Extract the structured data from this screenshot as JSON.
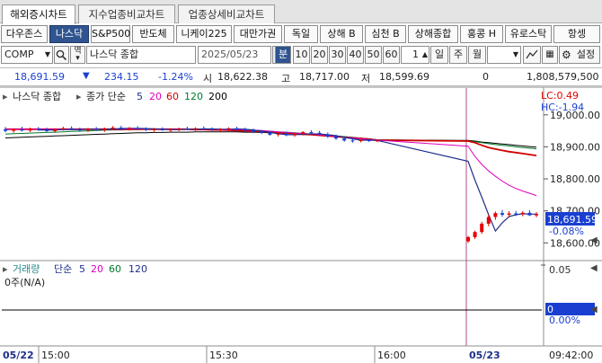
{
  "tabs": [
    "해외증시차트",
    "지수업종비교차트",
    "업종상세비교차트"
  ],
  "categories": [
    "다우존스",
    "나스닥",
    "S&P500",
    "반도체",
    "니케이225",
    "대만가권",
    "독일",
    "상해 B",
    "심천 B",
    "상해종합",
    "홍콩 H",
    "유로스탁",
    "항셍"
  ],
  "controls": {
    "symbol": "COMP",
    "index_name": "나스닥 종합",
    "date": "2025/05/23",
    "periods": [
      "분",
      "10",
      "20",
      "30",
      "40",
      "50",
      "60"
    ],
    "count": "1",
    "units": [
      "일",
      "주",
      "월"
    ],
    "settings_label": "설정"
  },
  "info": {
    "price": "18,691.59",
    "arrow": "▼",
    "change": "234.15",
    "change_pct": "-1.24%",
    "open_label": "시",
    "open": "18,622.38",
    "high_label": "고",
    "high": "18,717.00",
    "low_label": "저",
    "low": "18,599.69",
    "volume": "0",
    "amount": "1,808,579,500"
  },
  "price_panel": {
    "name": "나스닥 종합",
    "ma_label": "종가 단순",
    "ma_periods": [
      "5",
      "20",
      "60",
      "120",
      "200"
    ],
    "lc": "LC:0.49",
    "hc": "HC:-1.94",
    "y_ticks": [
      "19,000.00",
      "18,900.00",
      "18,800.00",
      "18,700.00",
      "18,600.00"
    ],
    "last_price": "18,691.59",
    "last_pct": "-0.08%"
  },
  "volume_panel": {
    "name": "거래량",
    "ma_label": "단순",
    "ma_periods": [
      "5",
      "20",
      "60",
      "120"
    ],
    "status": "0주(N/A)",
    "y_top": "0.05",
    "last_val": "0",
    "last_pct": "0.00%"
  },
  "x_axis": {
    "labels": [
      "05/22",
      "15:00",
      "15:30",
      "16:00",
      "05/23"
    ],
    "time": "09:42:00"
  },
  "colors": {
    "up": "#e60000",
    "down": "#1a3fd0",
    "ma5": "#1f2f8a",
    "ma20": "#e000c0",
    "ma60": "#d00000",
    "ma120": "#007a2e",
    "ma200": "#000000",
    "accent": "#2f5490"
  },
  "chart_data": {
    "type": "candlestick",
    "ylim": [
      18570,
      19050
    ],
    "candles": [
      {
        "o": 18955,
        "h": 18962,
        "l": 18945,
        "c": 18950
      },
      {
        "o": 18950,
        "h": 18958,
        "l": 18944,
        "c": 18955
      },
      {
        "o": 18955,
        "h": 18963,
        "l": 18948,
        "c": 18951
      },
      {
        "o": 18951,
        "h": 18960,
        "l": 18946,
        "c": 18957
      },
      {
        "o": 18957,
        "h": 18962,
        "l": 18950,
        "c": 18953
      },
      {
        "o": 18953,
        "h": 18960,
        "l": 18947,
        "c": 18949
      },
      {
        "o": 18949,
        "h": 18958,
        "l": 18944,
        "c": 18955
      },
      {
        "o": 18955,
        "h": 18963,
        "l": 18951,
        "c": 18958
      },
      {
        "o": 18958,
        "h": 18964,
        "l": 18952,
        "c": 18954
      },
      {
        "o": 18954,
        "h": 18960,
        "l": 18948,
        "c": 18952
      },
      {
        "o": 18952,
        "h": 18959,
        "l": 18946,
        "c": 18956
      },
      {
        "o": 18956,
        "h": 18962,
        "l": 18950,
        "c": 18953
      },
      {
        "o": 18953,
        "h": 18960,
        "l": 18947,
        "c": 18958
      },
      {
        "o": 18958,
        "h": 18965,
        "l": 18953,
        "c": 18960
      },
      {
        "o": 18960,
        "h": 18966,
        "l": 18954,
        "c": 18957
      },
      {
        "o": 18957,
        "h": 18962,
        "l": 18951,
        "c": 18959
      },
      {
        "o": 18959,
        "h": 18965,
        "l": 18954,
        "c": 18956
      },
      {
        "o": 18956,
        "h": 18961,
        "l": 18949,
        "c": 18953
      },
      {
        "o": 18953,
        "h": 18959,
        "l": 18947,
        "c": 18955
      },
      {
        "o": 18955,
        "h": 18961,
        "l": 18950,
        "c": 18952
      },
      {
        "o": 18952,
        "h": 18958,
        "l": 18946,
        "c": 18954
      },
      {
        "o": 18954,
        "h": 18960,
        "l": 18949,
        "c": 18957
      },
      {
        "o": 18957,
        "h": 18963,
        "l": 18952,
        "c": 18955
      },
      {
        "o": 18955,
        "h": 18961,
        "l": 18950,
        "c": 18958
      },
      {
        "o": 18958,
        "h": 18964,
        "l": 18953,
        "c": 18956
      },
      {
        "o": 18956,
        "h": 18961,
        "l": 18950,
        "c": 18953
      },
      {
        "o": 18953,
        "h": 18959,
        "l": 18947,
        "c": 18955
      },
      {
        "o": 18955,
        "h": 18961,
        "l": 18949,
        "c": 18958
      },
      {
        "o": 18958,
        "h": 18963,
        "l": 18952,
        "c": 18954
      },
      {
        "o": 18954,
        "h": 18960,
        "l": 18948,
        "c": 18952
      },
      {
        "o": 18952,
        "h": 18957,
        "l": 18943,
        "c": 18947
      },
      {
        "o": 18947,
        "h": 18953,
        "l": 18940,
        "c": 18944
      },
      {
        "o": 18944,
        "h": 18950,
        "l": 18935,
        "c": 18938
      },
      {
        "o": 18938,
        "h": 18946,
        "l": 18932,
        "c": 18941
      },
      {
        "o": 18941,
        "h": 18947,
        "l": 18933,
        "c": 18936
      },
      {
        "o": 18936,
        "h": 18944,
        "l": 18931,
        "c": 18940
      },
      {
        "o": 18940,
        "h": 18949,
        "l": 18936,
        "c": 18946
      },
      {
        "o": 18946,
        "h": 18952,
        "l": 18940,
        "c": 18944
      },
      {
        "o": 18944,
        "h": 18950,
        "l": 18936,
        "c": 18939
      },
      {
        "o": 18939,
        "h": 18945,
        "l": 18928,
        "c": 18932
      },
      {
        "o": 18932,
        "h": 18938,
        "l": 18922,
        "c": 18926
      },
      {
        "o": 18926,
        "h": 18930,
        "l": 18916,
        "c": 18920
      },
      {
        "o": 18920,
        "h": 18925,
        "l": 18913,
        "c": 18918
      },
      {
        "o": 18918,
        "h": 18924,
        "l": 18914,
        "c": 18921
      },
      {
        "o": 18921,
        "h": 18925,
        "l": 18915,
        "c": 18919
      },
      {
        "o": 18919,
        "h": 18923,
        "l": 18915,
        "c": 18920
      },
      {
        "o": 18605,
        "h": 18622,
        "l": 18600,
        "c": 18618
      },
      {
        "o": 18618,
        "h": 18638,
        "l": 18612,
        "c": 18634
      },
      {
        "o": 18634,
        "h": 18666,
        "l": 18628,
        "c": 18660
      },
      {
        "o": 18660,
        "h": 18688,
        "l": 18652,
        "c": 18681
      },
      {
        "o": 18681,
        "h": 18698,
        "l": 18672,
        "c": 18693
      },
      {
        "o": 18693,
        "h": 18703,
        "l": 18682,
        "c": 18688
      },
      {
        "o": 18688,
        "h": 18699,
        "l": 18680,
        "c": 18692
      },
      {
        "o": 18692,
        "h": 18700,
        "l": 18684,
        "c": 18690
      },
      {
        "o": 18690,
        "h": 18699,
        "l": 18683,
        "c": 18694
      },
      {
        "o": 18694,
        "h": 18702,
        "l": 18684,
        "c": 18686
      },
      {
        "o": 18686,
        "h": 18696,
        "l": 18680,
        "c": 18691
      }
    ],
    "ma200": [
      18928,
      18929,
      18930,
      18931,
      18932,
      18933,
      18934,
      18935,
      18936,
      18937,
      18938,
      18939,
      18940,
      18941,
      18942,
      18943,
      18944,
      18944,
      18945,
      18945,
      18946,
      18946,
      18946,
      18947,
      18947,
      18947,
      18947,
      18947,
      18947,
      18946,
      18946,
      18945,
      18944,
      18943,
      18942,
      18941,
      18940,
      18938,
      18937,
      18935,
      18933,
      18931,
      18929,
      18927,
      18925,
      18922,
      18920,
      18918,
      18915,
      18913,
      18911,
      18909,
      18907,
      18905,
      18903,
      18901,
      18899
    ],
    "ma120": [
      18940,
      18941,
      18942,
      18943,
      18944,
      18945,
      18946,
      18947,
      18948,
      18949,
      18950,
      18951,
      18952,
      18953,
      18953,
      18954,
      18954,
      18955,
      18955,
      18955,
      18955,
      18955,
      18955,
      18955,
      18955,
      18954,
      18954,
      18953,
      18953,
      18952,
      18951,
      18950,
      18949,
      18947,
      18946,
      18944,
      18942,
      18940,
      18938,
      18936,
      18934,
      18932,
      18930,
      18927,
      18925,
      18922,
      18919,
      18916,
      18913,
      18910,
      18907,
      18905,
      18903,
      18900,
      18898,
      18896,
      18894
    ],
    "ma60": [
      18955,
      18955,
      18955,
      18955,
      18955,
      18955,
      18955,
      18955,
      18955,
      18955,
      18955,
      18955,
      18955,
      18955,
      18955,
      18955,
      18955,
      18955,
      18955,
      18955,
      18955,
      18955,
      18955,
      18954,
      18954,
      18953,
      18953,
      18952,
      18951,
      18950,
      18949,
      18948,
      18946,
      18945,
      18943,
      18941,
      18939,
      18938,
      18936,
      18934,
      18932,
      18930,
      18928,
      18926,
      18924,
      18921,
      18918,
      18913,
      18905,
      18898,
      18893,
      18889,
      18885,
      18882,
      18879,
      18876,
      18873
    ],
    "ma20": [
      18955,
      18955,
      18955,
      18955,
      18955,
      18955,
      18955,
      18955,
      18955,
      18955,
      18955,
      18955,
      18955,
      18955,
      18955,
      18956,
      18956,
      18956,
      18956,
      18955,
      18955,
      18955,
      18955,
      18955,
      18955,
      18955,
      18954,
      18954,
      18954,
      18953,
      18952,
      18951,
      18949,
      18947,
      18945,
      18943,
      18942,
      18940,
      18938,
      18935,
      18933,
      18930,
      18928,
      18925,
      18923,
      18921,
      18902,
      18870,
      18845,
      18825,
      18808,
      18793,
      18780,
      18770,
      18762,
      18755,
      18748
    ],
    "ma5": [
      null,
      null,
      null,
      null,
      18953,
      18953,
      18953,
      18954,
      18954,
      18954,
      18955,
      18955,
      18955,
      18956,
      18957,
      18958,
      18958,
      18957,
      18956,
      18955,
      18954,
      18954,
      18955,
      18955,
      18956,
      18956,
      18955,
      18955,
      18956,
      18955,
      18953,
      18949,
      18945,
      18941,
      18938,
      18938,
      18939,
      18941,
      18940,
      18938,
      18935,
      18930,
      18925,
      18921,
      18921,
      18920,
      18855,
      18796,
      18743,
      18688,
      18637,
      18663,
      18682,
      18688,
      18691,
      18690,
      18690
    ]
  }
}
